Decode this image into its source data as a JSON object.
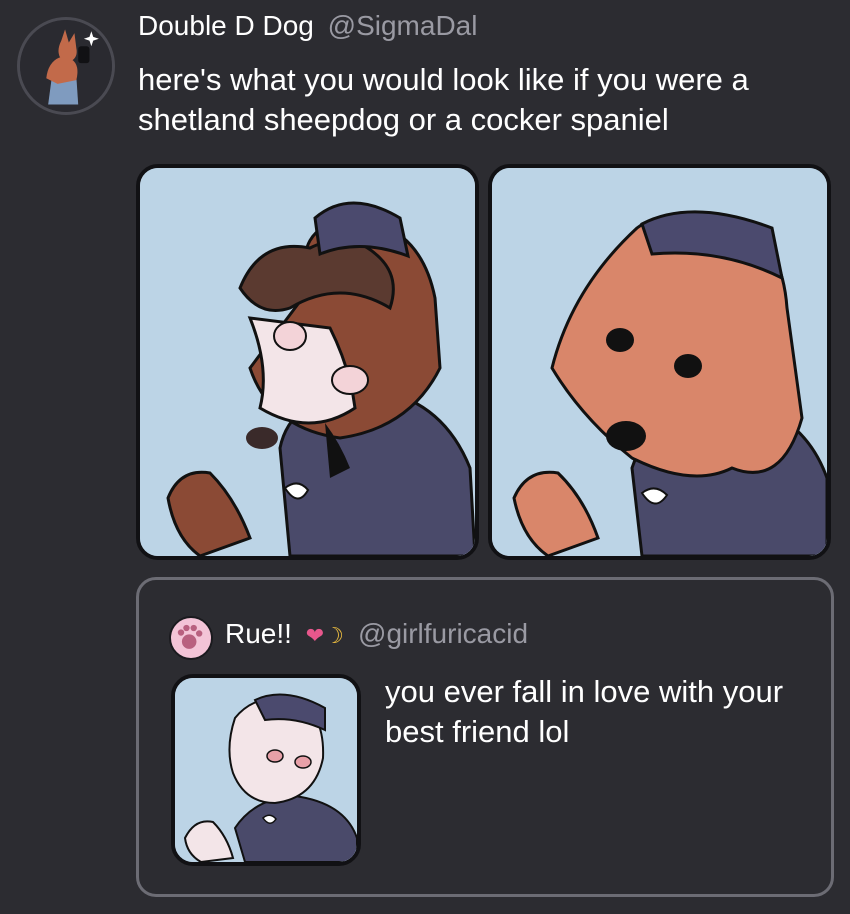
{
  "tweet": {
    "author_name": "Double D Dog",
    "author_handle": "@SigmaDal",
    "text": "here's what you would look like if you were a shetland sheepdog or a cocker spaniel",
    "media": [
      {
        "icon": "sheltie-dog-illustration"
      },
      {
        "icon": "cocker-spaniel-illustration"
      }
    ]
  },
  "quoted_tweet": {
    "author_name": "Rue!!",
    "author_emoji_heart": "❤",
    "author_emoji_moon": "☽",
    "author_handle": "@girlfuricacid",
    "text": "you ever fall in love with your best friend lol",
    "media_icon": "white-dog-illustration"
  },
  "colors": {
    "background": "#2c2c31",
    "panel_bg": "#bcd4e6",
    "handle": "#9a9aa3",
    "quote_border": "#6c6c74"
  }
}
